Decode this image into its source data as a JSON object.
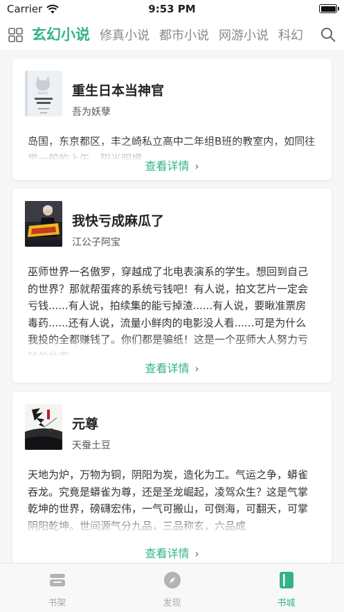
{
  "status_bar": {
    "carrier": "Carrier",
    "time": "9:53 PM"
  },
  "header": {
    "tabs": [
      {
        "label": "玄幻小说",
        "active": true
      },
      {
        "label": "修真小说",
        "active": false
      },
      {
        "label": "都市小说",
        "active": false
      },
      {
        "label": "网游小说",
        "active": false
      },
      {
        "label": "科幻",
        "active": false
      }
    ]
  },
  "books": [
    {
      "title": "重生日本当神官",
      "author": "吾为妖孽",
      "description": "岛国，东京都区，丰之崎私立高中二年组B班的教室内，如同往常一般的上午，阳光明媚，",
      "detail_label": "查看详情"
    },
    {
      "title": "我快亏成麻瓜了",
      "author": "江公子阿宝",
      "description": "巫师世界一名傲罗，穿越成了北电表演系的学生。想回到自己的世界？那就帮蛋疼的系统亏钱吧！有人说，拍文艺片一定会亏钱......有人说，拍续集的能亏掉渣......有人说，要瞅准票房毒药......还有人说，流量小鲜肉的电影没人看......可是为什么我投的全都赚钱了。你们都是骗纸！这是一个巫师大人努力亏钱的故事",
      "detail_label": "查看详情"
    },
    {
      "title": "元尊",
      "author": "天蚕土豆",
      "description": "天地为炉，万物为铜，阴阳为炭，造化为工。气运之争，蟒雀吞龙。究竟是蟒雀为尊，还是圣龙崛起，凌驾众生？这是气掌乾坤的世界，磅礴宏伟，一气可搬山，可倒海，可翻天，可掌阴阳乾坤。世间源气分九品，三品称玄，六品成",
      "detail_label": "查看详情"
    }
  ],
  "tabbar": {
    "items": [
      {
        "label": "书架",
        "icon": "bookshelf-icon",
        "active": false
      },
      {
        "label": "发现",
        "icon": "compass-icon",
        "active": false
      },
      {
        "label": "书城",
        "icon": "bookstore-icon",
        "active": true
      }
    ]
  },
  "colors": {
    "accent": "#35b28d",
    "inactive": "#aaaaaa"
  }
}
